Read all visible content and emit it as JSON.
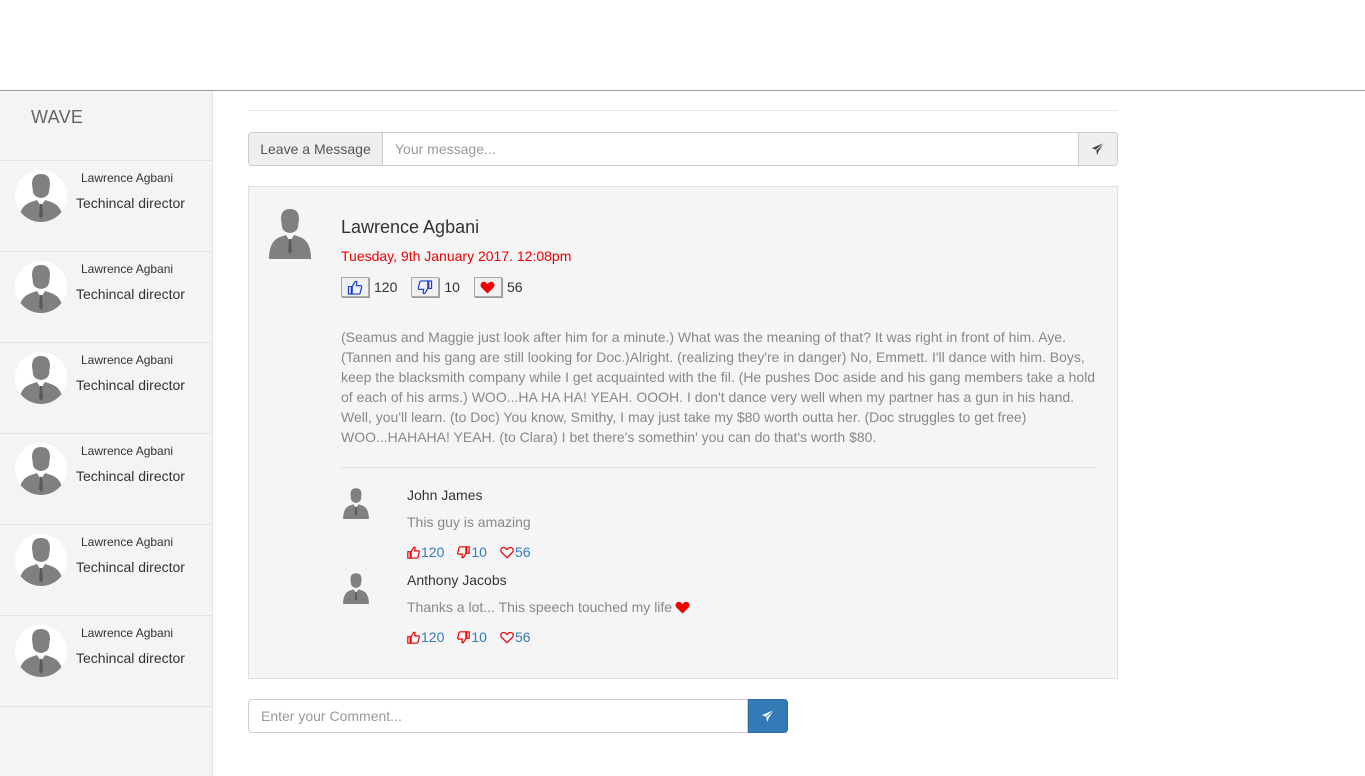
{
  "brand": "WAVE",
  "sidebar": {
    "items": [
      {
        "name": "Lawrence Agbani",
        "role": "Techincal director"
      },
      {
        "name": "Lawrence Agbani",
        "role": "Techincal director"
      },
      {
        "name": "Lawrence Agbani",
        "role": "Techincal director"
      },
      {
        "name": "Lawrence Agbani",
        "role": "Techincal director"
      },
      {
        "name": "Lawrence Agbani",
        "role": "Techincal director"
      },
      {
        "name": "Lawrence Agbani",
        "role": "Techincal director"
      }
    ]
  },
  "message_bar": {
    "addon_label": "Leave a Message",
    "placeholder": "Your message..."
  },
  "post": {
    "author": "Lawrence Agbani",
    "date": "Tuesday, 9th January 2017. 12:08pm",
    "likes": "120",
    "dislikes": "10",
    "hearts": "56",
    "body": "(Seamus and Maggie just look after him for a minute.) What was the meaning of that? It was right in front of him. Aye. (Tannen and his gang are still looking for Doc.)Alright. (realizing they're in danger) No, Emmett. I'll dance with him. Boys, keep the blacksmith company while I get acquainted with the fil. (He pushes Doc aside and his gang members take a hold of each of his arms.) WOO...HA HA HA! YEAH. OOOH. I don't dance very well when my partner has a gun in his hand. Well, you'll learn. (to Doc) You know, Smithy, I may just take my $80 worth outta her. (Doc struggles to get free) WOO...HAHAHA! YEAH. (to Clara) I bet there's somethin' you can do that's worth $80."
  },
  "comments": [
    {
      "name": "John James",
      "text": "This guy is amazing",
      "likes": "120",
      "dislikes": "10",
      "hearts": "56"
    },
    {
      "name": "Anthony Jacobs",
      "text": "Thanks a lot... This speech touched my life",
      "likes": "120",
      "dislikes": "10",
      "hearts": "56"
    }
  ],
  "comment_bar": {
    "placeholder": "Enter your Comment..."
  },
  "colors": {
    "accent": "#337ab7",
    "date": "#ee0000",
    "heart": "#ee0000",
    "thumb_blue": "#1a3fd1"
  }
}
